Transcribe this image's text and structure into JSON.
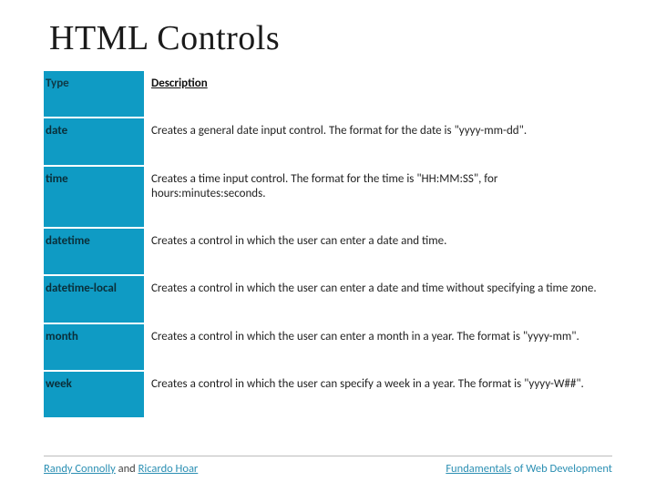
{
  "title": "HTML Controls",
  "headers": {
    "type": "Type",
    "desc": "Description"
  },
  "rows": [
    {
      "type": "date",
      "desc": "Creates a general date input control. The format for the date is \"yyyy-mm-dd\"."
    },
    {
      "type": "time",
      "desc": "Creates a time input control. The format for the time is \"HH:MM:SS\", for hours:minutes:seconds."
    },
    {
      "type": "datetime",
      "desc": "Creates a control in which the user can enter a date and time."
    },
    {
      "type": "datetime-local",
      "desc": "Creates a control in which the user can enter a date and time without specifying a time zone."
    },
    {
      "type": "month",
      "desc": "Creates a control in which the user can enter a month in a year. The format is \"yyyy-mm\"."
    },
    {
      "type": "week",
      "desc": "Creates a control in which the user can specify a week in a year. The format is \"yyyy-W##\"."
    }
  ],
  "footer": {
    "author1": "Randy Connolly",
    "join": " and ",
    "author2": "Ricardo Hoar",
    "book_w1": "Fundamentals",
    "book_rest": " of Web Development"
  }
}
